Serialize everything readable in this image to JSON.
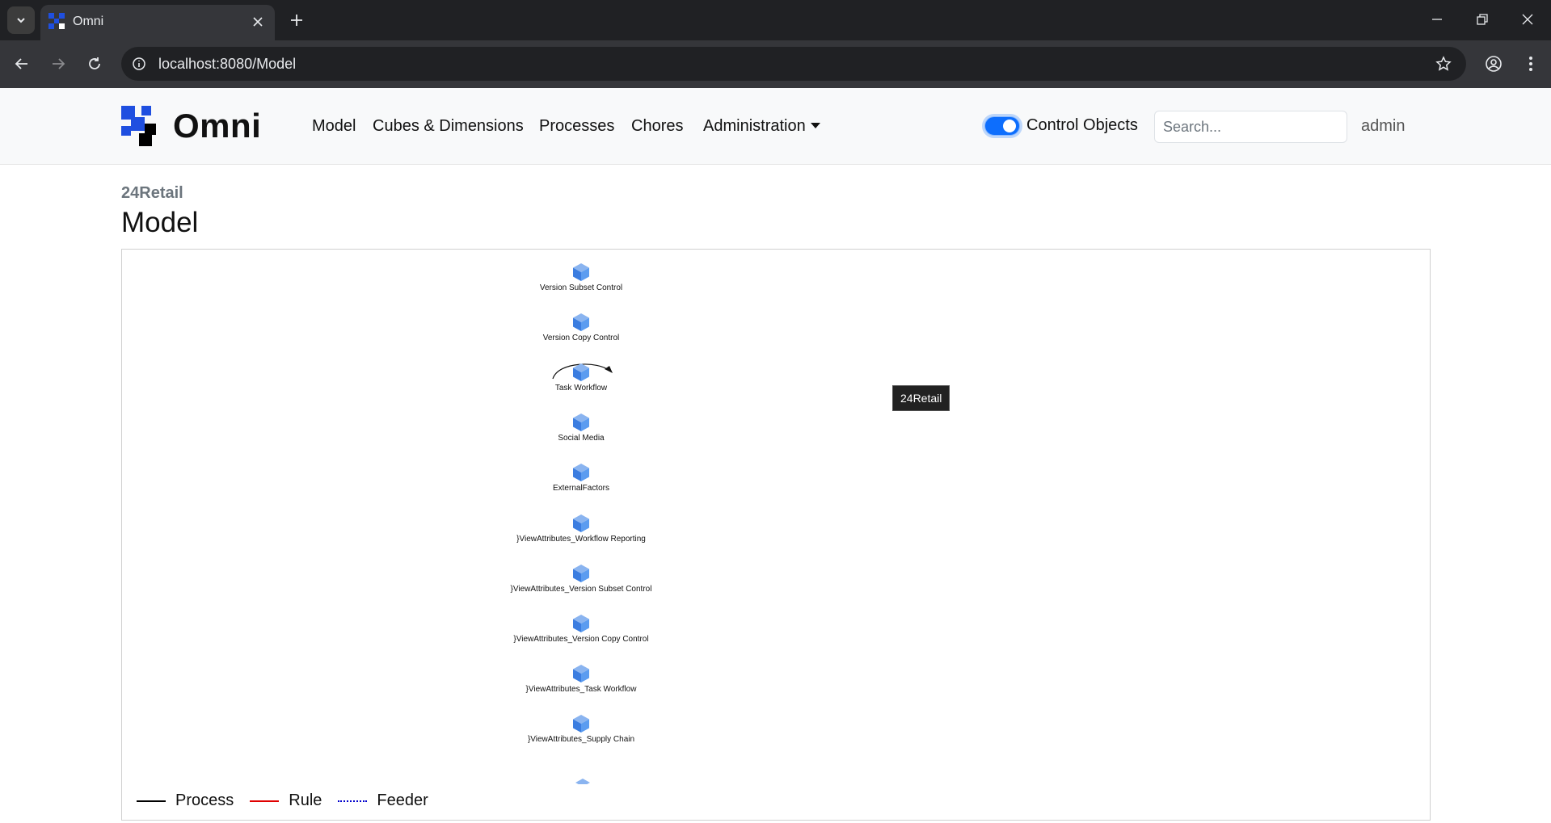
{
  "browser": {
    "tab_title": "Omni",
    "url": "localhost:8080/Model"
  },
  "navbar": {
    "brand": "Omni",
    "links": [
      "Model",
      "Cubes & Dimensions",
      "Processes",
      "Chores"
    ],
    "admin_menu": "Administration",
    "toggle_label": "Control Objects",
    "toggle_on": true,
    "search_placeholder": "Search...",
    "user": "admin"
  },
  "page": {
    "subtitle": "24Retail",
    "title": "Model"
  },
  "model": {
    "tooltip": "24Retail",
    "cubes": [
      "Version Subset Control",
      "Version Copy Control",
      "Task Workflow",
      "Social Media",
      "ExternalFactors",
      "}ViewAttributes_Workflow Reporting",
      "}ViewAttributes_Version Subset Control",
      "}ViewAttributes_Version Copy Control",
      "}ViewAttributes_Task Workflow",
      "}ViewAttributes_Supply Chain"
    ],
    "legend": {
      "process": "Process",
      "rule": "Rule",
      "feeder": "Feeder"
    }
  },
  "colors": {
    "accent": "#0d6efd",
    "cube": "#4a90e2",
    "process_line": "#000000",
    "rule_line": "#e00000",
    "feeder_line": "#0000cc"
  }
}
